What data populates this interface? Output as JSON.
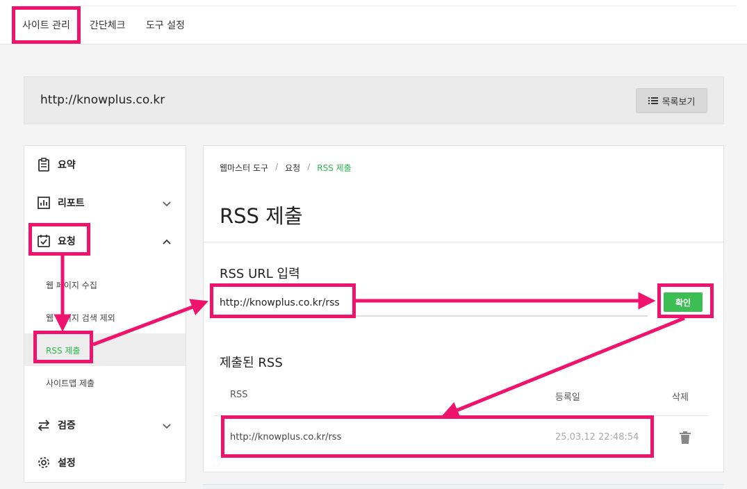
{
  "top_tabs": [
    "사이트 관리",
    "간단체크",
    "도구 설정"
  ],
  "site_url": "http://knowplus.co.kr",
  "list_button_label": "목록보기",
  "sidebar": {
    "items": [
      {
        "label": "요약",
        "icon": "clipboard-icon"
      },
      {
        "label": "리포트",
        "icon": "bar-chart-icon"
      },
      {
        "label": "요청",
        "icon": "clipboard-check-icon"
      },
      {
        "label": "검증",
        "icon": "swap-arrows-icon"
      },
      {
        "label": "설정",
        "icon": "gear-icon"
      }
    ],
    "subitems": [
      "웹 페이지 수집",
      "웹 페이지 검색 제외",
      "RSS 제출",
      "사이트맵 제출"
    ]
  },
  "breadcrumb": [
    "웹마스터 도구",
    "요청",
    "RSS 제출"
  ],
  "page_title": "RSS 제출",
  "rss_input": {
    "section_title": "RSS URL 입력",
    "value": "http://knowplus.co.kr/rss",
    "confirm_label": "확인"
  },
  "submitted": {
    "section_title": "제출된 RSS",
    "columns": [
      "RSS",
      "등록일",
      "삭제"
    ],
    "rows": [
      {
        "rss": "http://knowplus.co.kr/rss",
        "date": "25.03.12 22:48:54"
      }
    ]
  },
  "colors": {
    "accent_green": "#3cbe54",
    "highlight_pink": "#f0136e"
  }
}
